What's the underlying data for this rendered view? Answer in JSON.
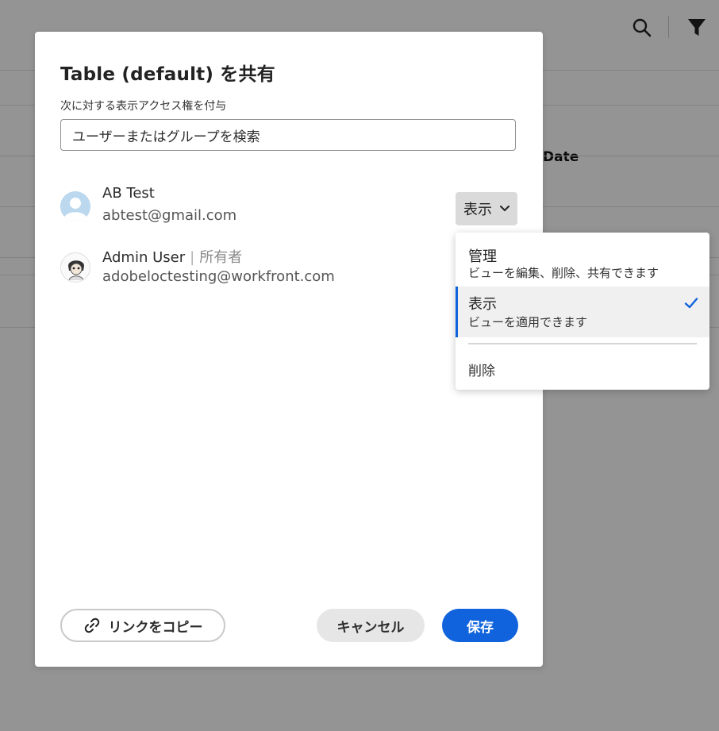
{
  "background": {
    "column_header": "Date"
  },
  "modal": {
    "title": "Table (default) を共有",
    "grant_label": "次に対する表示アクセス権を付与",
    "search_placeholder": "ユーザーまたはグループを検索",
    "users": [
      {
        "name": "AB Test",
        "email": "abtest@gmail.com",
        "role": "表示"
      },
      {
        "name": "Admin User",
        "separator": "|",
        "owner_label": "所有者",
        "email": "adobeloctesting@workfront.com"
      }
    ],
    "copy_link_label": "リンクをコピー",
    "cancel_label": "キャンセル",
    "save_label": "保存"
  },
  "role_menu": {
    "items": [
      {
        "title": "管理",
        "description": "ビューを編集、削除、共有できます"
      },
      {
        "title": "表示",
        "description": "ビューを適用できます",
        "selected": true
      }
    ],
    "delete_label": "削除"
  },
  "colors": {
    "accent": "#1063dc",
    "overlay": "rgba(0,0,0,0.42)"
  },
  "icons": [
    "search-icon",
    "filter-icon",
    "link-icon",
    "chevron-down-icon",
    "checkmark-icon",
    "avatar-icon"
  ]
}
